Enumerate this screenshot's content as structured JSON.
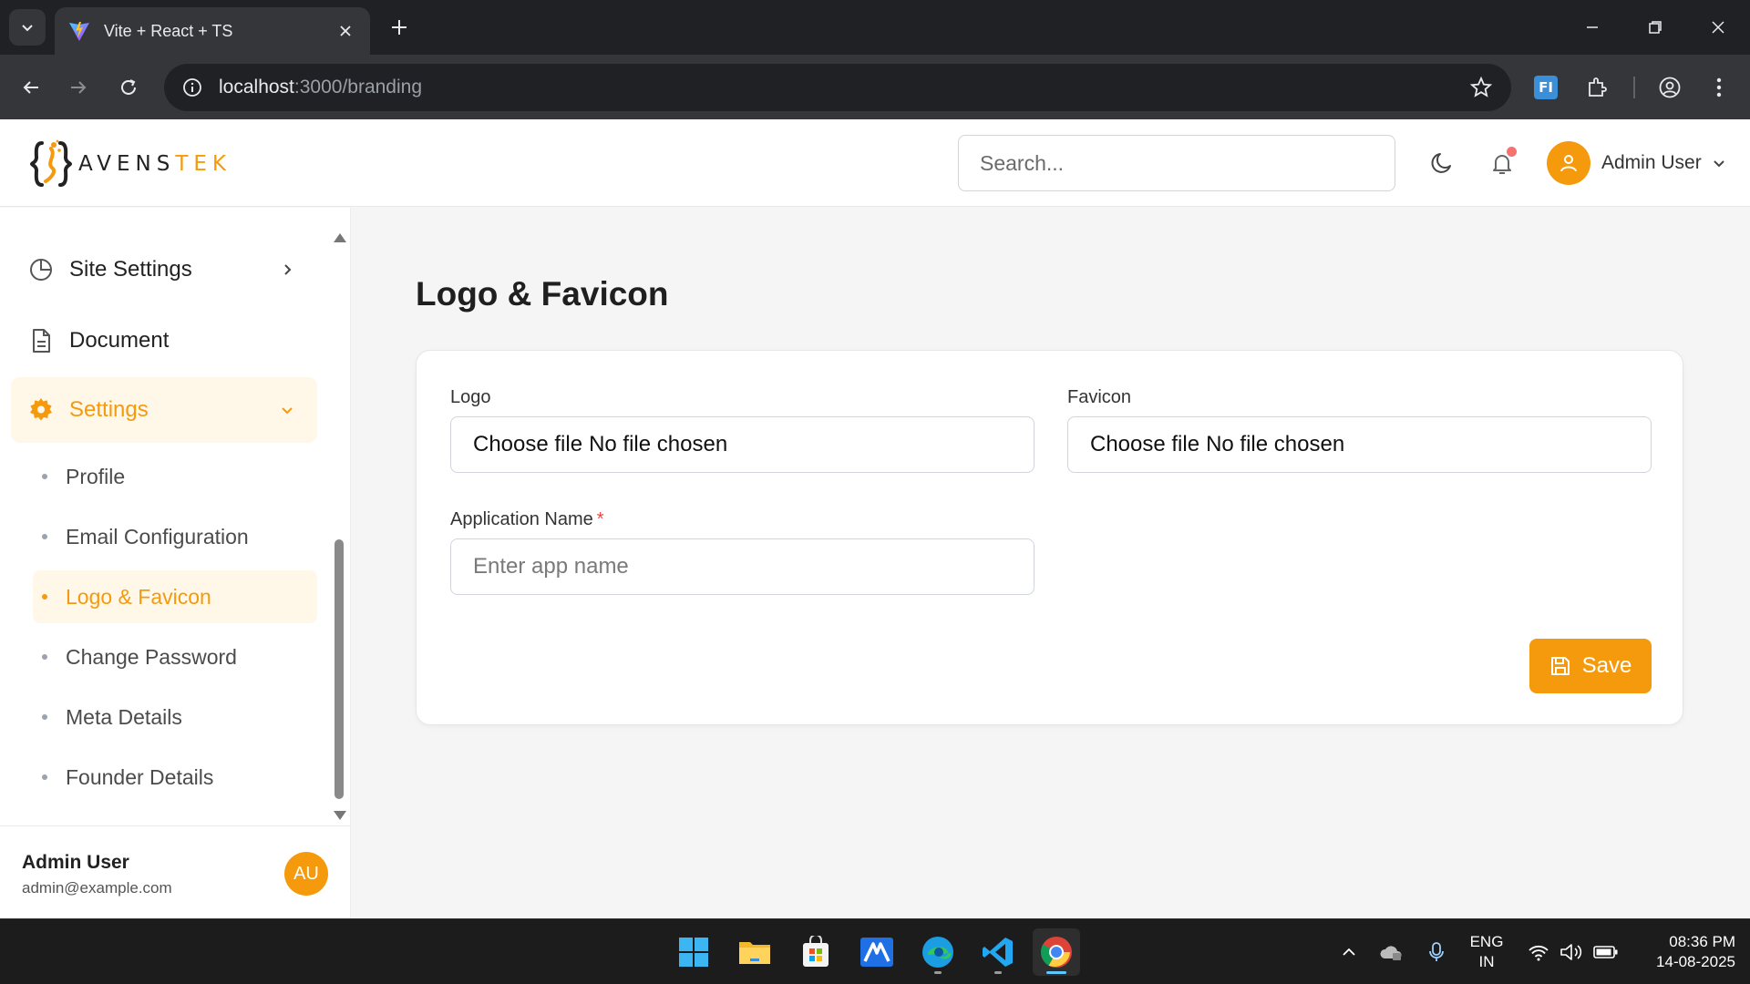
{
  "browser": {
    "tab_title": "Vite + React + TS",
    "url_host": "localhost",
    "url_path": ":3000/branding",
    "extension_label": "FI"
  },
  "header": {
    "logo_text_main": "AVENS",
    "logo_text_accent": "TEK",
    "search_placeholder": "Search...",
    "user_name": "Admin User"
  },
  "sidebar": {
    "items": [
      {
        "label": "Site Settings",
        "icon": "pie-chart-icon"
      },
      {
        "label": "Document",
        "icon": "document-icon"
      },
      {
        "label": "Settings",
        "icon": "gear-icon"
      }
    ],
    "sub_items": [
      {
        "label": "Profile"
      },
      {
        "label": "Email Configuration"
      },
      {
        "label": "Logo & Favicon"
      },
      {
        "label": "Change Password"
      },
      {
        "label": "Meta Details"
      },
      {
        "label": "Founder Details"
      }
    ],
    "footer": {
      "name": "Admin User",
      "email": "admin@example.com",
      "initials": "AU"
    }
  },
  "main": {
    "title": "Logo & Favicon",
    "logo_label": "Logo",
    "favicon_label": "Favicon",
    "file_button": "Choose file",
    "file_status": "No file chosen",
    "app_name_label": "Application Name",
    "app_name_required": "*",
    "app_name_placeholder": "Enter app name",
    "save_label": "Save"
  },
  "taskbar": {
    "lang_line1": "ENG",
    "lang_line2": "IN",
    "time": "08:36 PM",
    "date": "14-08-2025"
  },
  "colors": {
    "accent": "#f59a0c",
    "accent_light": "#fff7e8",
    "notification": "#f87171"
  }
}
